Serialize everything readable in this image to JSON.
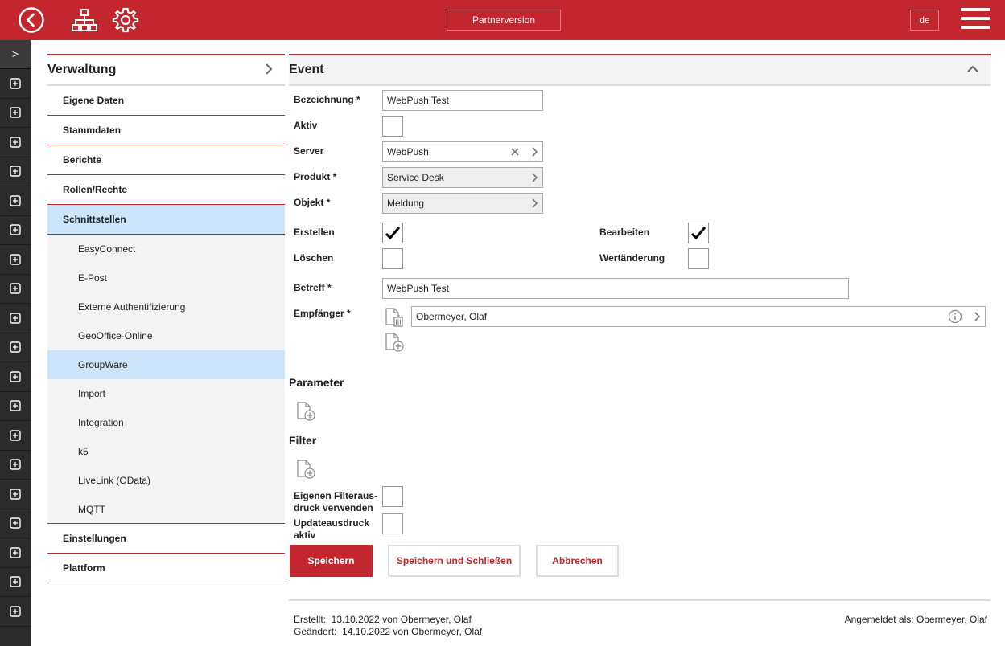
{
  "topbar": {
    "back_icon": "back-circle-icon",
    "network_icon": "sitemap-icon",
    "settings_icon": "gear-icon",
    "partner_label": "Partnerversion",
    "lang_label": "de",
    "menu_icon": "hamburger-icon"
  },
  "rail": {
    "toggle": ">",
    "icons": [
      "map-pin-icon",
      "building-icon",
      "tools-icon",
      "tree-icon",
      "map-photo-icon",
      "box-icon",
      "printer-icon",
      "cart-icon",
      "pen-icon",
      "network-icon",
      "map-icon",
      "calendar-icon",
      "tunnel-icon",
      "car-icon",
      "location-icon",
      "home-icon",
      "bolt-icon",
      "map-icon",
      "cube-network-icon"
    ]
  },
  "nav": {
    "title": "Verwaltung",
    "items": [
      {
        "label": "Eigene Daten"
      },
      {
        "label": "Stammdaten"
      },
      {
        "label": "Berichte"
      },
      {
        "label": "Rollen/Rechte"
      },
      {
        "label": "Schnittstellen"
      }
    ],
    "subitems": [
      {
        "label": "EasyConnect"
      },
      {
        "label": "E-Post"
      },
      {
        "label": "Externe Authentifizierung"
      },
      {
        "label": "GeoOffice-Online"
      },
      {
        "label": "GroupWare"
      },
      {
        "label": "Import"
      },
      {
        "label": "Integration"
      },
      {
        "label": "k5"
      },
      {
        "label": "LiveLink (OData)"
      },
      {
        "label": "MQTT"
      }
    ],
    "bottom_items": [
      {
        "label": "Einstellungen"
      },
      {
        "label": "Plattform"
      }
    ]
  },
  "form": {
    "title": "Event",
    "bezeichnung_label": "Bezeichnung *",
    "bezeichnung_value": "WebPush Test",
    "aktiv_label": "Aktiv",
    "aktiv_checked": false,
    "server_label": "Server",
    "server_value": "WebPush",
    "produkt_label": "Produkt *",
    "produkt_value": "Service Desk",
    "objekt_label": "Objekt *",
    "objekt_value": "Meldung",
    "erstellen_label": "Erstellen",
    "erstellen_checked": true,
    "bearbeiten_label": "Bearbeiten",
    "bearbeiten_checked": true,
    "loeschen_label": "Löschen",
    "loeschen_checked": false,
    "wertaenderung_label": "Wertänderung",
    "wertaenderung_checked": false,
    "betreff_label": "Betreff *",
    "betreff_value": "WebPush Test",
    "empfaenger_label": "Empfänger *",
    "empfaenger_value": "Obermeyer, Olaf",
    "parameter_title": "Parameter",
    "filter_title": "Filter",
    "eigener_filter_label_1": "Eigenen Filteraus-",
    "eigener_filter_label_2": "druck verwenden",
    "update_label_1": "Updateausdruck",
    "update_label_2": "aktiv"
  },
  "buttons": {
    "save": "Speichern",
    "save_close": "Speichern und Schließen",
    "cancel": "Abbrechen"
  },
  "footer": {
    "created": "Erstellt:  13.10.2022 von Obermeyer, Olaf",
    "modified": "Geändert:  14.10.2022 von Obermeyer, Olaf",
    "logged_in": "Angemeldet als: Obermeyer, Olaf"
  },
  "colors": {
    "brand": "#c4262e",
    "active_bg": "#cce5fb",
    "rail": "#2b2b2b"
  }
}
